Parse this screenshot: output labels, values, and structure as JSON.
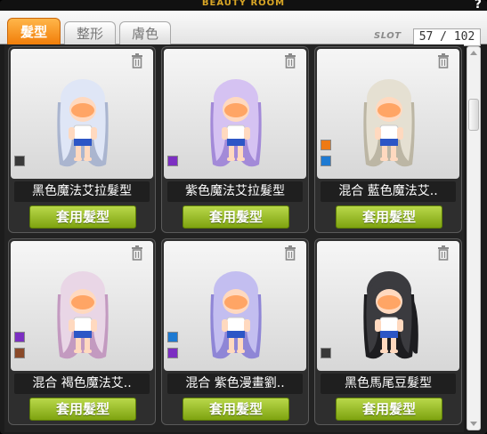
{
  "window": {
    "title": "BEAUTY ROOM",
    "help_label": "?"
  },
  "tabs": [
    {
      "label": "髮型",
      "active": true
    },
    {
      "label": "整形",
      "active": false
    },
    {
      "label": "膚色",
      "active": false
    }
  ],
  "slot": {
    "label": "SLOT",
    "value": "57 / 102"
  },
  "cards": [
    {
      "name": "黑色魔法艾拉髮型",
      "button": "套用髮型",
      "swatches": [
        "#3a3a3a"
      ],
      "hair": "#dfe6f6",
      "hair_dark": "#aab5cf"
    },
    {
      "name": "紫色魔法艾拉髮型",
      "button": "套用髮型",
      "swatches": [
        "#7c2fc2"
      ],
      "hair": "#d5c2f2",
      "hair_dark": "#a38ad8"
    },
    {
      "name": "混合 藍色魔法艾..",
      "button": "套用髮型",
      "swatches": [
        "#ee7a15",
        "#1e7ad2"
      ],
      "hair": "#e5e0d2",
      "hair_dark": "#bcb6a4"
    },
    {
      "name": "混合 褐色魔法艾..",
      "button": "套用髮型",
      "swatches": [
        "#7c2fc2",
        "#8a4a2a"
      ],
      "hair": "#e9d6e6",
      "hair_dark": "#c39ac0"
    },
    {
      "name": "混合 紫色漫畫劉..",
      "button": "套用髮型",
      "swatches": [
        "#1e7ad2",
        "#7c2fc2"
      ],
      "hair": "#c3bef0",
      "hair_dark": "#8f86d6"
    },
    {
      "name": "黑色馬尾豆髮型",
      "button": "套用髮型",
      "swatches": [
        "#3a3a3a"
      ],
      "hair": "#3b3b3f",
      "hair_dark": "#1d1d20"
    }
  ],
  "icons": {
    "trash": "trash-icon",
    "scroll_up": "scroll-up-icon",
    "scroll_down": "scroll-down-icon"
  }
}
